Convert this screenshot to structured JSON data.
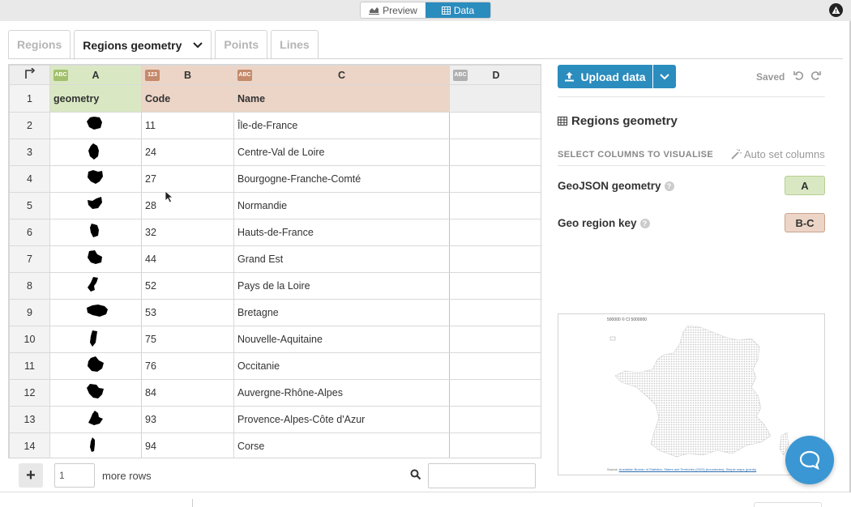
{
  "topbar": {
    "preview_label": "Preview",
    "data_label": "Data",
    "icons": {
      "preview": "chart-icon",
      "data": "table-icon",
      "warning": "warning-icon"
    }
  },
  "tabs": [
    {
      "label": "Regions",
      "active": false
    },
    {
      "label": "Regions geometry",
      "active": true
    },
    {
      "label": "Points",
      "active": false
    },
    {
      "label": "Lines",
      "active": false
    }
  ],
  "grid": {
    "columns": [
      {
        "letter": "A",
        "type": "ABC",
        "name": "geometry",
        "color": "#d9e8c3"
      },
      {
        "letter": "B",
        "type": "123",
        "name": "Code",
        "color": "#ecd5c7"
      },
      {
        "letter": "C",
        "type": "ABC",
        "name": "Name",
        "color": "#ecd5c7"
      },
      {
        "letter": "D",
        "type": "ABC",
        "name": "",
        "color": "#eeeeee"
      }
    ],
    "rows": [
      {
        "num": "2",
        "code": "11",
        "name": "Île-de-France"
      },
      {
        "num": "3",
        "code": "24",
        "name": "Centre-Val de Loire"
      },
      {
        "num": "4",
        "code": "27",
        "name": "Bourgogne-Franche-Comté"
      },
      {
        "num": "5",
        "code": "28",
        "name": "Normandie"
      },
      {
        "num": "6",
        "code": "32",
        "name": "Hauts-de-France"
      },
      {
        "num": "7",
        "code": "44",
        "name": "Grand Est"
      },
      {
        "num": "8",
        "code": "52",
        "name": "Pays de la Loire"
      },
      {
        "num": "9",
        "code": "53",
        "name": "Bretagne"
      },
      {
        "num": "10",
        "code": "75",
        "name": "Nouvelle-Aquitaine"
      },
      {
        "num": "11",
        "code": "76",
        "name": "Occitanie"
      },
      {
        "num": "12",
        "code": "84",
        "name": "Auvergne-Rhône-Alpes"
      },
      {
        "num": "13",
        "code": "93",
        "name": "Provence-Alpes-Côte d'Azur"
      },
      {
        "num": "14",
        "code": "94",
        "name": "Corse"
      }
    ],
    "header_row_num": "1"
  },
  "footer_controls": {
    "rows_value": "1",
    "more_rows_label": "more rows",
    "search_placeholder": ""
  },
  "sidebar": {
    "upload_label": "Upload data",
    "saved_label": "Saved",
    "sheet_title": "Regions geometry",
    "select_columns_label": "SELECT COLUMNS TO VISUALISE",
    "auto_set_label": "Auto set columns",
    "dimensions": [
      {
        "label": "GeoJSON geometry",
        "value": "A"
      },
      {
        "label": "Geo region key",
        "value": "B-C"
      }
    ]
  },
  "map_preview": {
    "scale_note": "500000 © CI 5000000",
    "source_prefix": "Source: ",
    "source_link": "Australian Bureau of Statistics, States and Territories (2023) (boundaries), Simple maps (points)"
  },
  "colors": {
    "accent": "#2b8cbe",
    "geo_col": "#d9e8c3",
    "key_col": "#ecd5c7"
  }
}
